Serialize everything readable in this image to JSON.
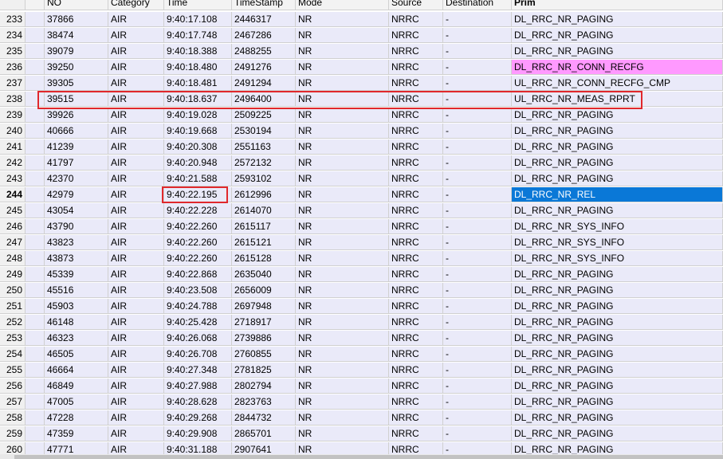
{
  "columns": [
    {
      "key": "no",
      "label": "NO"
    },
    {
      "key": "category",
      "label": "Category"
    },
    {
      "key": "time",
      "label": "Time"
    },
    {
      "key": "timestamp",
      "label": "TimeStamp"
    },
    {
      "key": "mode",
      "label": "Mode"
    },
    {
      "key": "source",
      "label": "Source"
    },
    {
      "key": "destination",
      "label": "Destination"
    },
    {
      "key": "prim",
      "label": "Prim"
    }
  ],
  "rows": [
    {
      "rownum": "233",
      "no": "37866",
      "category": "AIR",
      "time": "9:40:17.108",
      "timestamp": "2446317",
      "mode": "NR",
      "source": "NRRC",
      "destination": "-",
      "prim": "DL_RRC_NR_PAGING"
    },
    {
      "rownum": "234",
      "no": "38474",
      "category": "AIR",
      "time": "9:40:17.748",
      "timestamp": "2467286",
      "mode": "NR",
      "source": "NRRC",
      "destination": "-",
      "prim": "DL_RRC_NR_PAGING"
    },
    {
      "rownum": "235",
      "no": "39079",
      "category": "AIR",
      "time": "9:40:18.388",
      "timestamp": "2488255",
      "mode": "NR",
      "source": "NRRC",
      "destination": "-",
      "prim": "DL_RRC_NR_PAGING"
    },
    {
      "rownum": "236",
      "no": "39250",
      "category": "AIR",
      "time": "9:40:18.480",
      "timestamp": "2491276",
      "mode": "NR",
      "source": "NRRC",
      "destination": "-",
      "prim": "DL_RRC_NR_CONN_RECFG",
      "prim_style": "pink"
    },
    {
      "rownum": "237",
      "no": "39305",
      "category": "AIR",
      "time": "9:40:18.481",
      "timestamp": "2491294",
      "mode": "NR",
      "source": "NRRC",
      "destination": "-",
      "prim": "UL_RRC_NR_CONN_RECFG_CMP"
    },
    {
      "rownum": "238",
      "no": "39515",
      "category": "AIR",
      "time": "9:40:18.637",
      "timestamp": "2496400",
      "mode": "NR",
      "source": "NRRC",
      "destination": "-",
      "prim": "UL_RRC_NR_MEAS_RPRT",
      "row_highlight": true
    },
    {
      "rownum": "239",
      "no": "39926",
      "category": "AIR",
      "time": "9:40:19.028",
      "timestamp": "2509225",
      "mode": "NR",
      "source": "NRRC",
      "destination": "-",
      "prim": "DL_RRC_NR_PAGING"
    },
    {
      "rownum": "240",
      "no": "40666",
      "category": "AIR",
      "time": "9:40:19.668",
      "timestamp": "2530194",
      "mode": "NR",
      "source": "NRRC",
      "destination": "-",
      "prim": "DL_RRC_NR_PAGING"
    },
    {
      "rownum": "241",
      "no": "41239",
      "category": "AIR",
      "time": "9:40:20.308",
      "timestamp": "2551163",
      "mode": "NR",
      "source": "NRRC",
      "destination": "-",
      "prim": "DL_RRC_NR_PAGING"
    },
    {
      "rownum": "242",
      "no": "41797",
      "category": "AIR",
      "time": "9:40:20.948",
      "timestamp": "2572132",
      "mode": "NR",
      "source": "NRRC",
      "destination": "-",
      "prim": "DL_RRC_NR_PAGING"
    },
    {
      "rownum": "243",
      "no": "42370",
      "category": "AIR",
      "time": "9:40:21.588",
      "timestamp": "2593102",
      "mode": "NR",
      "source": "NRRC",
      "destination": "-",
      "prim": "DL_RRC_NR_PAGING"
    },
    {
      "rownum": "244",
      "no": "42979",
      "category": "AIR",
      "time": "9:40:22.195",
      "timestamp": "2612996",
      "mode": "NR",
      "source": "NRRC",
      "destination": "-",
      "prim": "DL_RRC_NR_REL",
      "prim_style": "selected",
      "time_highlight": true,
      "active": true
    },
    {
      "rownum": "245",
      "no": "43054",
      "category": "AIR",
      "time": "9:40:22.228",
      "timestamp": "2614070",
      "mode": "NR",
      "source": "NRRC",
      "destination": "-",
      "prim": "DL_RRC_NR_PAGING"
    },
    {
      "rownum": "246",
      "no": "43790",
      "category": "AIR",
      "time": "9:40:22.260",
      "timestamp": "2615117",
      "mode": "NR",
      "source": "NRRC",
      "destination": "-",
      "prim": "DL_RRC_NR_SYS_INFO"
    },
    {
      "rownum": "247",
      "no": "43823",
      "category": "AIR",
      "time": "9:40:22.260",
      "timestamp": "2615121",
      "mode": "NR",
      "source": "NRRC",
      "destination": "-",
      "prim": "DL_RRC_NR_SYS_INFO"
    },
    {
      "rownum": "248",
      "no": "43873",
      "category": "AIR",
      "time": "9:40:22.260",
      "timestamp": "2615128",
      "mode": "NR",
      "source": "NRRC",
      "destination": "-",
      "prim": "DL_RRC_NR_SYS_INFO"
    },
    {
      "rownum": "249",
      "no": "45339",
      "category": "AIR",
      "time": "9:40:22.868",
      "timestamp": "2635040",
      "mode": "NR",
      "source": "NRRC",
      "destination": "-",
      "prim": "DL_RRC_NR_PAGING"
    },
    {
      "rownum": "250",
      "no": "45516",
      "category": "AIR",
      "time": "9:40:23.508",
      "timestamp": "2656009",
      "mode": "NR",
      "source": "NRRC",
      "destination": "-",
      "prim": "DL_RRC_NR_PAGING"
    },
    {
      "rownum": "251",
      "no": "45903",
      "category": "AIR",
      "time": "9:40:24.788",
      "timestamp": "2697948",
      "mode": "NR",
      "source": "NRRC",
      "destination": "-",
      "prim": "DL_RRC_NR_PAGING"
    },
    {
      "rownum": "252",
      "no": "46148",
      "category": "AIR",
      "time": "9:40:25.428",
      "timestamp": "2718917",
      "mode": "NR",
      "source": "NRRC",
      "destination": "-",
      "prim": "DL_RRC_NR_PAGING"
    },
    {
      "rownum": "253",
      "no": "46323",
      "category": "AIR",
      "time": "9:40:26.068",
      "timestamp": "2739886",
      "mode": "NR",
      "source": "NRRC",
      "destination": "-",
      "prim": "DL_RRC_NR_PAGING"
    },
    {
      "rownum": "254",
      "no": "46505",
      "category": "AIR",
      "time": "9:40:26.708",
      "timestamp": "2760855",
      "mode": "NR",
      "source": "NRRC",
      "destination": "-",
      "prim": "DL_RRC_NR_PAGING"
    },
    {
      "rownum": "255",
      "no": "46664",
      "category": "AIR",
      "time": "9:40:27.348",
      "timestamp": "2781825",
      "mode": "NR",
      "source": "NRRC",
      "destination": "-",
      "prim": "DL_RRC_NR_PAGING"
    },
    {
      "rownum": "256",
      "no": "46849",
      "category": "AIR",
      "time": "9:40:27.988",
      "timestamp": "2802794",
      "mode": "NR",
      "source": "NRRC",
      "destination": "-",
      "prim": "DL_RRC_NR_PAGING"
    },
    {
      "rownum": "257",
      "no": "47005",
      "category": "AIR",
      "time": "9:40:28.628",
      "timestamp": "2823763",
      "mode": "NR",
      "source": "NRRC",
      "destination": "-",
      "prim": "DL_RRC_NR_PAGING"
    },
    {
      "rownum": "258",
      "no": "47228",
      "category": "AIR",
      "time": "9:40:29.268",
      "timestamp": "2844732",
      "mode": "NR",
      "source": "NRRC",
      "destination": "-",
      "prim": "DL_RRC_NR_PAGING"
    },
    {
      "rownum": "259",
      "no": "47359",
      "category": "AIR",
      "time": "9:40:29.908",
      "timestamp": "2865701",
      "mode": "NR",
      "source": "NRRC",
      "destination": "-",
      "prim": "DL_RRC_NR_PAGING"
    },
    {
      "rownum": "260",
      "no": "47771",
      "category": "AIR",
      "time": "9:40:31.188",
      "timestamp": "2907641",
      "mode": "NR",
      "source": "NRRC",
      "destination": "-",
      "prim": "DL_RRC_NR_PAGING"
    }
  ],
  "colors": {
    "row_bg": "#eaeaf9",
    "pink_cell": "#ff99ff",
    "selected_cell": "#0a78d7",
    "highlight_box": "#e0282c"
  }
}
